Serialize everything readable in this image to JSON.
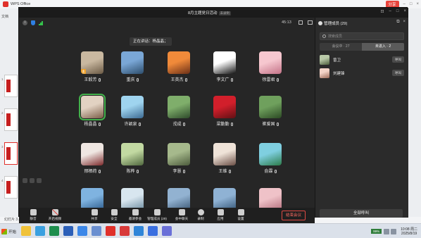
{
  "wps": {
    "title": "WPS Office",
    "tab_label": "文档",
    "share_label": "分享",
    "status": "幻灯片 3 / 4",
    "slide_numbers": [
      "1",
      "2",
      "3",
      "4"
    ]
  },
  "meeting": {
    "title": "8月主题党日活动",
    "title_tag": "未录制",
    "timer": "45:13",
    "speaking": "正在讲话：杨晶晶；",
    "participants": [
      {
        "name": "王毅芳",
        "colors": [
          "#c9b8a0",
          "#6b5a45"
        ],
        "host": true
      },
      {
        "name": "重庆",
        "colors": [
          "#7aa7d6",
          "#2d4d6b"
        ],
        "host": false
      },
      {
        "name": "王英杰",
        "colors": [
          "#f08a3a",
          "#6b2f17"
        ],
        "host": false
      },
      {
        "name": "李文广",
        "colors": [
          "#ffffff",
          "#111111"
        ],
        "host": false
      },
      {
        "name": "徐雷君",
        "colors": [
          "#f6c7cf",
          "#c47388"
        ],
        "host": false
      },
      {
        "name": "杨晶晶",
        "colors": [
          "#e2d2c2",
          "#7b5d48"
        ],
        "host": false,
        "selected": true
      },
      {
        "name": "许颖泉",
        "colors": [
          "#9fd4ef",
          "#3c6a92"
        ],
        "host": false
      },
      {
        "name": "戎成",
        "colors": [
          "#7fae6b",
          "#2e4a2b"
        ],
        "host": false
      },
      {
        "name": "梁勤勤",
        "colors": [
          "#d21f2b",
          "#611014"
        ],
        "host": false
      },
      {
        "name": "崔爱国",
        "colors": [
          "#6fa05d",
          "#2c4a24"
        ],
        "host": false
      },
      {
        "name": "邢栖荷",
        "colors": [
          "#efe7e2",
          "#7d2a2c"
        ],
        "host": false
      },
      {
        "name": "陈桦",
        "colors": [
          "#c2d9a2",
          "#50683e"
        ],
        "host": false
      },
      {
        "name": "李慧",
        "colors": [
          "#a6b98c",
          "#4c5b3c"
        ],
        "host": false
      },
      {
        "name": "王维",
        "colors": [
          "#efe3d8",
          "#6a4e45"
        ],
        "host": false
      },
      {
        "name": "俞霖",
        "colors": [
          "#7fcfe0",
          "#2c7c4a"
        ],
        "host": false
      },
      {
        "name": "",
        "colors": [
          "#7fb3e0",
          "#2c5b8c"
        ],
        "host": false
      },
      {
        "name": "",
        "colors": [
          "#d8e6ef",
          "#6b8a9e"
        ],
        "host": false
      },
      {
        "name": "",
        "colors": [
          "#92b2d1",
          "#3a5672"
        ],
        "host": false
      },
      {
        "name": "",
        "colors": [
          "#8fb2d4",
          "#345575"
        ],
        "host": false
      },
      {
        "name": "",
        "colors": [
          "#efc2c8",
          "#b36d7b"
        ],
        "host": false
      }
    ]
  },
  "toolbar": {
    "items": [
      {
        "label": "静音",
        "icon": "mic-icon"
      },
      {
        "label": "开启视频",
        "icon": "video-off-icon"
      },
      {
        "label": "共享",
        "icon": "share-screen-icon"
      },
      {
        "label": "安全",
        "icon": "security-icon"
      },
      {
        "label": "邀请参会",
        "icon": "invite-icon"
      },
      {
        "label": "管理成员 (29)",
        "icon": "members-icon"
      },
      {
        "label": "会中聊天",
        "icon": "chat-icon"
      },
      {
        "label": "录制",
        "icon": "record-icon"
      },
      {
        "label": "应用",
        "icon": "apps-icon"
      },
      {
        "label": "设置",
        "icon": "settings-icon"
      }
    ],
    "end_label": "结束会议"
  },
  "panel": {
    "title": "管理成员 (29)",
    "search_placeholder": "搜索成员",
    "tabs": [
      {
        "label": "会议中 · 27",
        "active": false
      },
      {
        "label": "未进入 · 2",
        "active": true
      }
    ],
    "members": [
      {
        "name": "曾卫",
        "call_label": "呼叫",
        "colors": [
          "#b9c9a8",
          "#4c5e3c"
        ]
      },
      {
        "name": "刘建锋",
        "call_label": "呼叫",
        "colors": [
          "#f3d4c8",
          "#9c6a58"
        ]
      }
    ],
    "call_all_label": "全部呼叫"
  },
  "taskbar": {
    "start_label": "开始",
    "input_method": "99%",
    "clock_time": "10:08 周二",
    "clock_date": "2025/8/19",
    "pinned": [
      {
        "icon": "qq-icon",
        "color": "#f0c23a"
      },
      {
        "icon": "ie-icon",
        "color": "#3aa0e0"
      },
      {
        "icon": "excel-icon",
        "color": "#1e8e4e"
      },
      {
        "icon": "word-icon",
        "color": "#2b5fb8"
      },
      {
        "icon": "browser-icon",
        "color": "#3b87e8"
      },
      {
        "icon": "doc-icon",
        "color": "#6a8fd0"
      },
      {
        "icon": "wps-icon",
        "color": "#e0302a"
      },
      {
        "icon": "pdf-icon",
        "color": "#d83a3a"
      },
      {
        "icon": "folder-icon",
        "color": "#2f85d8"
      },
      {
        "icon": "meeting-icon",
        "color": "#3a6fe0"
      },
      {
        "icon": "photo-icon",
        "color": "#6a70d8"
      }
    ]
  }
}
